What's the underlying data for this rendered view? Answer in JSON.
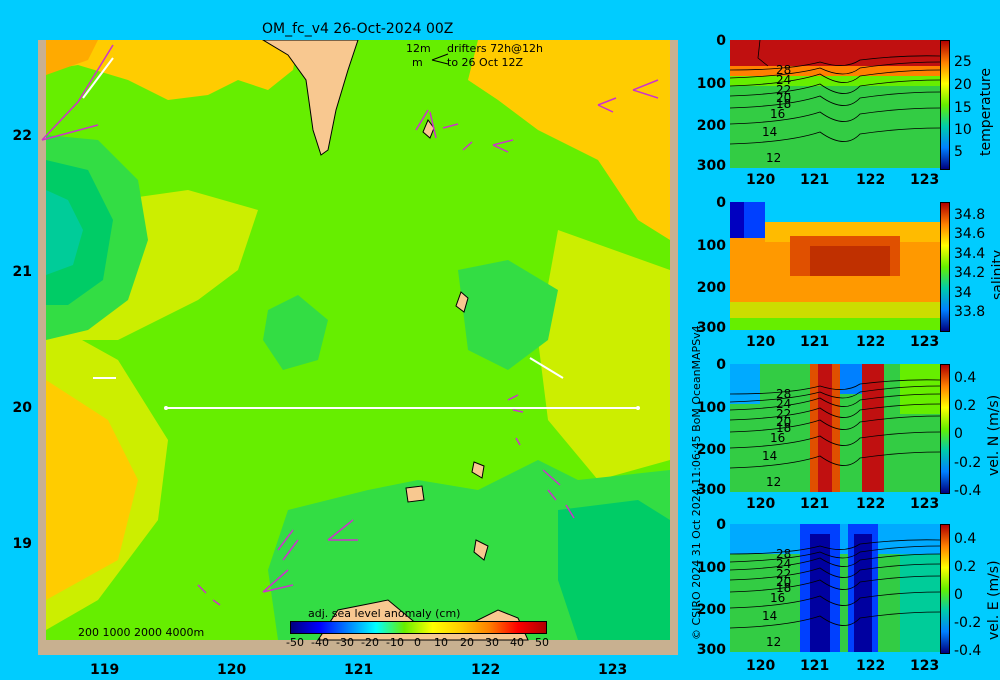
{
  "title": "OM_fc_v4  26-Oct-2024 00Z",
  "legend": {
    "scale_vel": "12m",
    "scale_unit": "m",
    "drifters_line1": "drifters 72h@12h",
    "drifters_line2": "to 26 Oct 12Z"
  },
  "map": {
    "xticks": [
      "119",
      "120",
      "121",
      "122",
      "123"
    ],
    "yticks": [
      "22",
      "21",
      "20",
      "19"
    ],
    "bathy_labels": "200  1000  2000  4000m",
    "colorbar_title": "adj. sea level anomaly (cm)",
    "colorbar_ticks": [
      "-50",
      "-40",
      "-30",
      "-20",
      "-10",
      "0",
      "10",
      "20",
      "30",
      "40",
      "50"
    ],
    "colors": {
      "sea_low": "#00CC66",
      "sea_mid": "#66EE00",
      "sea_high": "#FFCC00",
      "land": "#F8C890"
    }
  },
  "side_panels": {
    "xticks": [
      "120",
      "121",
      "122",
      "123"
    ],
    "yticks": [
      "0",
      "100",
      "200",
      "300"
    ],
    "panels": [
      {
        "id": "temperature",
        "label": "temperature",
        "cbar_ticks": [
          "25",
          "20",
          "15",
          "10",
          "5"
        ],
        "contour_labels": [
          "28",
          "24",
          "22",
          "20",
          "18",
          "16",
          "14",
          "12"
        ]
      },
      {
        "id": "salinity",
        "label": "salinity",
        "cbar_ticks": [
          "34.8",
          "34.6",
          "34.4",
          "34.2",
          "34",
          "33.8"
        ],
        "contour_labels": []
      },
      {
        "id": "vel_n",
        "label": "vel. N (m/s)",
        "cbar_ticks": [
          "0.4",
          "0.2",
          "0",
          "-0.2",
          "-0.4"
        ],
        "contour_labels": [
          "28",
          "24",
          "22",
          "20",
          "18",
          "16",
          "14",
          "12"
        ]
      },
      {
        "id": "vel_e",
        "label": "vel. E (m/s)",
        "cbar_ticks": [
          "0.4",
          "0.2",
          "0",
          "-0.2",
          "-0.4"
        ],
        "contour_labels": [
          "28",
          "24",
          "22",
          "20",
          "18",
          "16",
          "14",
          "12"
        ]
      }
    ]
  },
  "credit": "© CSIRO 2024   31 Oct 2024 11:06:45 BoM OceanMAPSv4"
}
